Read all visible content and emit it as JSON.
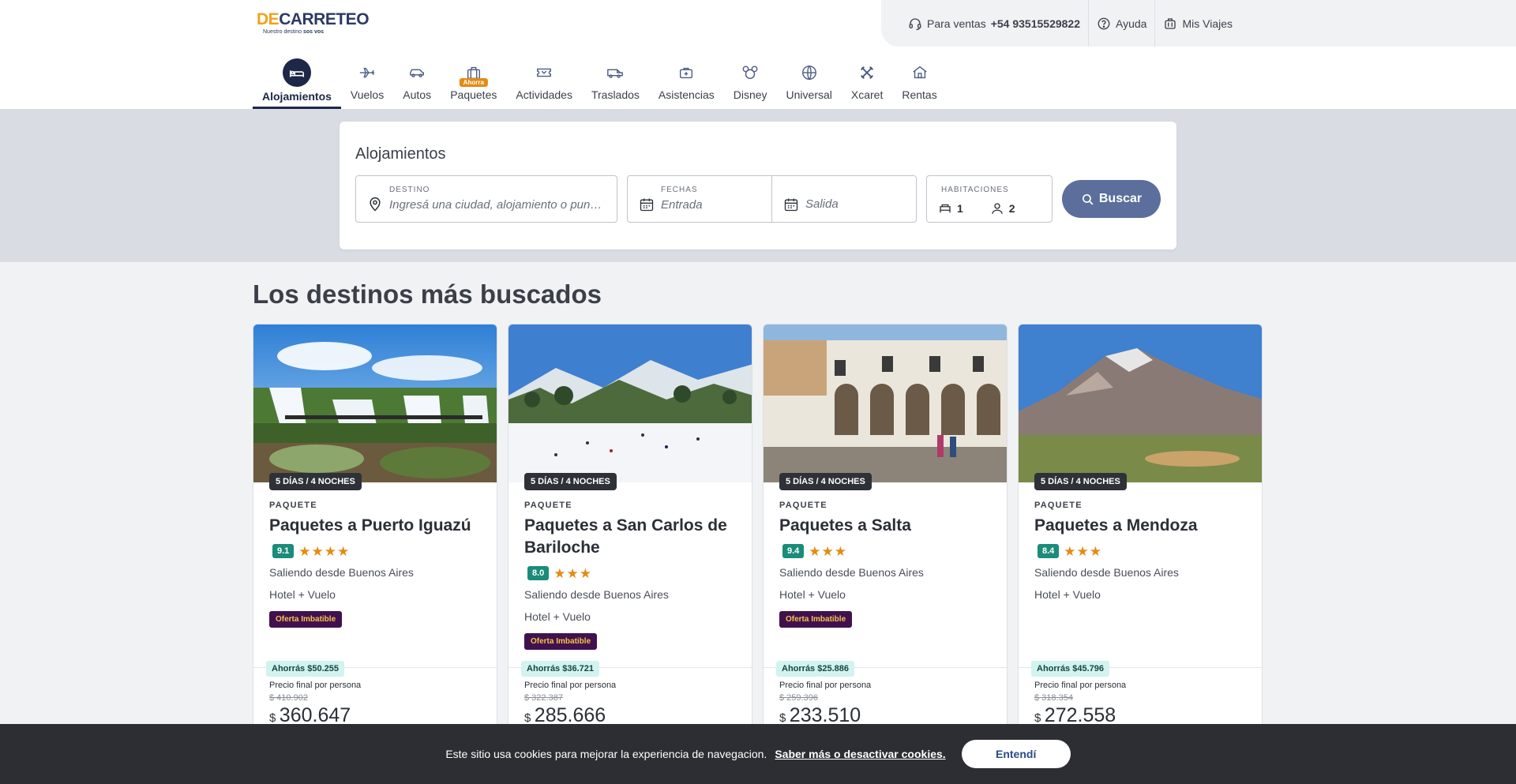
{
  "brand": {
    "logo_main_prefix": "DE",
    "logo_main_rest": "CARRETEO",
    "logo_sub_text": "Nuestro destino",
    "logo_sub_bold": "sos vos"
  },
  "utility": {
    "sales_label": "Para ventas",
    "sales_phone": "+54 93515529822",
    "help": "Ayuda",
    "trips": "Mis Viajes"
  },
  "nav": {
    "items": [
      {
        "label": "Alojamientos",
        "icon": "bed-icon"
      },
      {
        "label": "Vuelos",
        "icon": "plane-icon"
      },
      {
        "label": "Autos",
        "icon": "car-icon"
      },
      {
        "label": "Paquetes",
        "icon": "suitcase-icon",
        "badge": "Ahorra"
      },
      {
        "label": "Actividades",
        "icon": "ticket-icon"
      },
      {
        "label": "Traslados",
        "icon": "van-icon"
      },
      {
        "label": "Asistencias",
        "icon": "medkit-icon"
      },
      {
        "label": "Disney",
        "icon": "mouse-ears-icon"
      },
      {
        "label": "Universal",
        "icon": "globe-icon"
      },
      {
        "label": "Xcaret",
        "icon": "xcaret-icon"
      },
      {
        "label": "Rentas",
        "icon": "house-icon"
      }
    ]
  },
  "search": {
    "title": "Alojamientos",
    "destination_label": "DESTINO",
    "destination_placeholder": "Ingresá una ciudad, alojamiento o punt...",
    "dates_label": "FECHAS",
    "checkin_placeholder": "Entrada",
    "checkout_placeholder": "Salida",
    "rooms_label": "HABITACIONES",
    "rooms_value": "1",
    "guests_value": "2",
    "button": "Buscar"
  },
  "destinations": {
    "title": "Los destinos más buscados",
    "cards": [
      {
        "nights": "5 DÍAS / 4 NOCHES",
        "kind": "PAQUETE",
        "title": "Paquetes a Puerto Iguazú",
        "score": "9.1",
        "stars": 4,
        "origin": "Saliendo desde Buenos Aires",
        "includes": "Hotel + Vuelo",
        "offer": "Oferta Imbatible",
        "save": "Ahorrás $50.255",
        "price_label": "Precio final por persona",
        "price_old": "$ 410.902",
        "currency": "$",
        "price": "360.647"
      },
      {
        "nights": "5 DÍAS / 4 NOCHES",
        "kind": "PAQUETE",
        "title": "Paquetes a San Carlos de Bariloche",
        "score": "8.0",
        "stars": 3,
        "origin": "Saliendo desde Buenos Aires",
        "includes": "Hotel + Vuelo",
        "offer": "Oferta Imbatible",
        "save": "Ahorrás $36.721",
        "price_label": "Precio final por persona",
        "price_old": "$ 322.387",
        "currency": "$",
        "price": "285.666"
      },
      {
        "nights": "5 DÍAS / 4 NOCHES",
        "kind": "PAQUETE",
        "title": "Paquetes a Salta",
        "score": "9.4",
        "stars": 3,
        "origin": "Saliendo desde Buenos Aires",
        "includes": "Hotel + Vuelo",
        "offer": "Oferta Imbatible",
        "save": "Ahorrás $25.886",
        "price_label": "Precio final por persona",
        "price_old": "$ 259.396",
        "currency": "$",
        "price": "233.510"
      },
      {
        "nights": "5 DÍAS / 4 NOCHES",
        "kind": "PAQUETE",
        "title": "Paquetes a Mendoza",
        "score": "8.4",
        "stars": 3,
        "origin": "Saliendo desde Buenos Aires",
        "includes": "Hotel + Vuelo",
        "offer": "",
        "save": "Ahorrás $45.796",
        "price_label": "Precio final por persona",
        "price_old": "$ 318.354",
        "currency": "$",
        "price": "272.558"
      }
    ]
  },
  "cookie": {
    "text": "Este sitio usa cookies para mejorar la experiencia de navegacion.",
    "link": "Saber más o desactivar cookies.",
    "accept": "Entendí"
  },
  "colors": {
    "primary": "#1d2747",
    "search_button": "#5b6e9c",
    "score": "#1b8c7a",
    "offer_bg": "#40114f",
    "offer_text": "#f6c445",
    "save_bg": "#d2f3ef",
    "star": "#e38b13"
  }
}
